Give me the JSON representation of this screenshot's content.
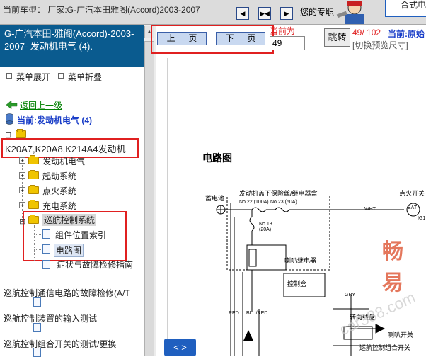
{
  "topbar": {
    "vehicle_text": "当前车型： 厂家:G-广汽本田雅阁(Accord)2003-2007",
    "btn_prev": "◀",
    "btn_pause": "▶◀",
    "btn_next": "▶",
    "prof_label": "您的专职",
    "logo_text": "合式电"
  },
  "sidebar": {
    "title": "G-广汽本田-雅阁(Accord)-2003-2007- 发动机电气 (4).",
    "expand_label": "菜单展开",
    "collapse_label": "菜单折叠",
    "back_label": "返回上一级",
    "current_label": "当前:发动机电气 (4)",
    "root_plus": "⊟",
    "engine_label": "K20A7,K20A8,K214A4发动机",
    "items": [
      {
        "label": "发动机电气"
      },
      {
        "label": "起动系统"
      },
      {
        "label": "点火系统"
      },
      {
        "label": "充电系统"
      },
      {
        "label": "巡航控制系统"
      },
      {
        "label": "组件位置索引"
      },
      {
        "label": "电路图"
      },
      {
        "label": "症状与故障检修指南"
      },
      {
        "label": "巡航控制通信电路的故障检修(A/T"
      },
      {
        "label": "巡航控制装置的输入测试"
      },
      {
        "label": "巡航控制组合开关的测试/更换"
      }
    ]
  },
  "pager": {
    "prev_label": "上 一 页",
    "next_label": "下 一 页",
    "current_prefix": "当前为",
    "page_value": "49",
    "jump_label": "跳转",
    "count_text": "49/ 102",
    "current_doc": "当前:原始",
    "preview_size": "[切换预览尺寸]",
    "bottom_nav": "< >"
  },
  "diagram": {
    "title": "电路图",
    "battery": "蓄电池",
    "fusebox": "发动机盖下保险丝/继电器盒",
    "fuse1": "No.22 (100A)",
    "fuse2": "No.23 (50A)",
    "fuse3": "No.13",
    "fuse3b": "(20A)",
    "wire_whit": "WHT",
    "ignition": "点火开关",
    "bat": "BAT",
    "ig1": "IG1",
    "horn_relay": "喇叭继电器",
    "control_box": "控制盒",
    "gry": "GRY",
    "steer": "转向线盘",
    "horn_switch": "喇叭开关",
    "cruise_switch": "巡航控制组合开关",
    "red": "RED",
    "blu_red": "BLU/RED",
    "watermark": "畅易",
    "watermark2": "car388.com"
  },
  "colors": {
    "title_bar": "#0a5b8f",
    "highlight": "#e02020",
    "link_green": "#008000",
    "current_blue": "#1a3ec8"
  }
}
